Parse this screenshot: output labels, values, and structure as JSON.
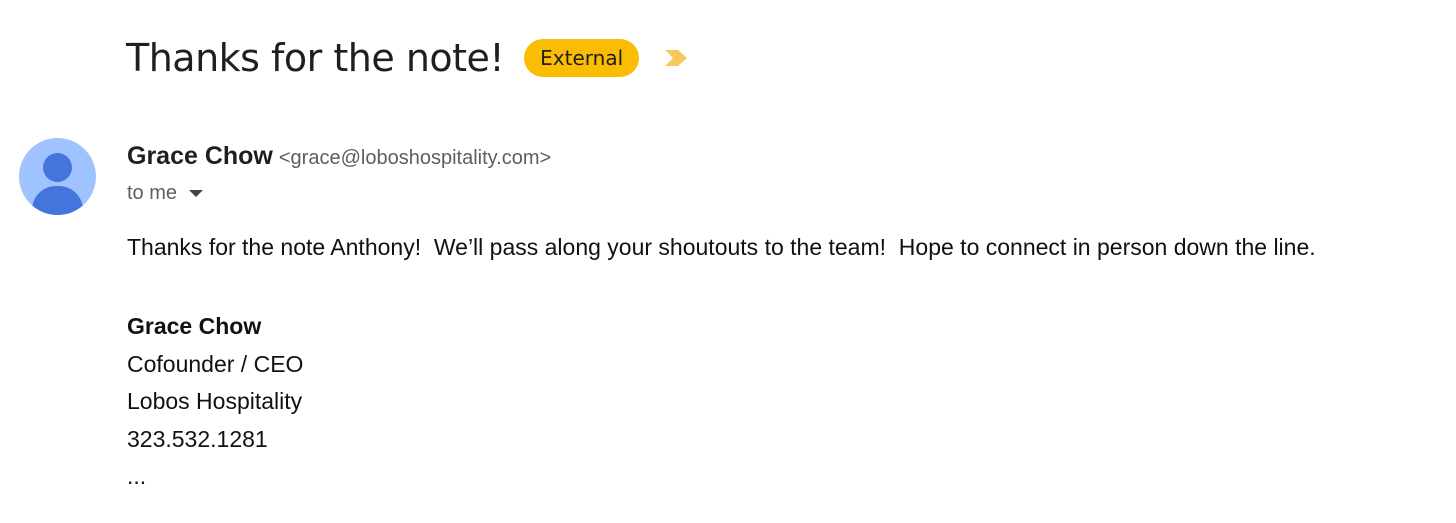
{
  "email": {
    "subject": "Thanks for the note!",
    "label_badge": "External",
    "important_marker_icon": "important-chevron-icon",
    "colors": {
      "badge_bg": "#fbbc04",
      "important_marker": "#f8c85a",
      "avatar_bg": "#a0c3ff",
      "avatar_fg": "#4375dc"
    },
    "sender": {
      "name": "Grace Chow",
      "email": "<grace@loboshospitality.com>",
      "avatar_icon": "person-avatar-icon"
    },
    "recipient_line": "to me",
    "body": "Thanks for the note Anthony!  We’ll pass along your shoutouts to the team!  Hope to connect in person down the line.",
    "signature": {
      "name": "Grace Chow",
      "title": "Cofounder / CEO",
      "company": "Lobos Hospitality",
      "phone": "323.532.1281",
      "trimmed_content": "..."
    }
  }
}
